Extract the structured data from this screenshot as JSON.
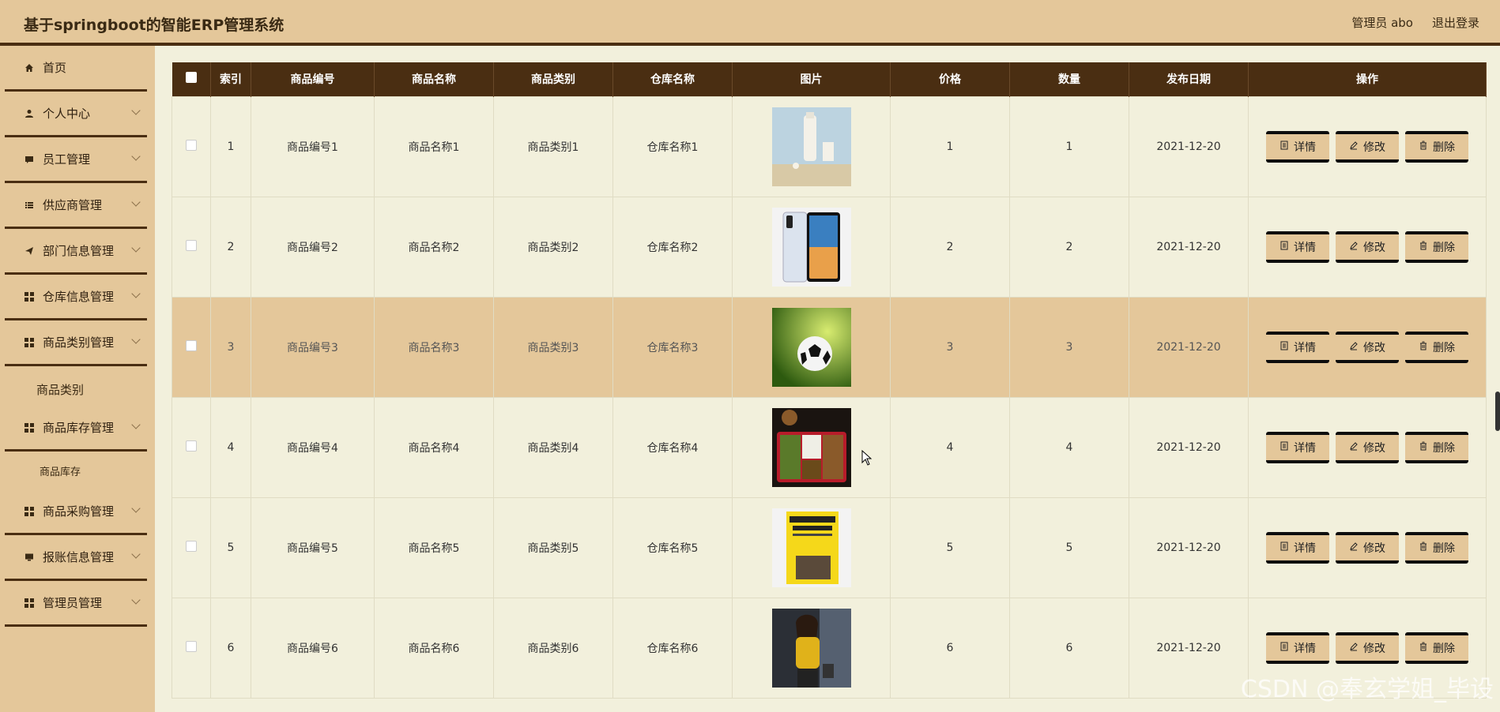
{
  "header": {
    "title": "基于springboot的智能ERP管理系统",
    "user": "管理员 abo",
    "logout": "退出登录"
  },
  "sidebar": {
    "items": [
      {
        "label": "首页"
      },
      {
        "label": "个人中心"
      },
      {
        "label": "员工管理"
      },
      {
        "label": "供应商管理"
      },
      {
        "label": "部门信息管理"
      },
      {
        "label": "仓库信息管理"
      },
      {
        "label": "商品类别管理"
      },
      {
        "label": "商品库存管理"
      },
      {
        "label": "商品采购管理"
      },
      {
        "label": "报账信息管理"
      },
      {
        "label": "管理员管理"
      }
    ],
    "sub_category": "商品类别",
    "sub_stock": "商品库存"
  },
  "table": {
    "headers": [
      "索引",
      "商品编号",
      "商品名称",
      "商品类别",
      "仓库名称",
      "图片",
      "价格",
      "数量",
      "发布日期",
      "操作"
    ],
    "rows": [
      {
        "index": "1",
        "code": "商品编号1",
        "name": "商品名称1",
        "category": "商品类别1",
        "warehouse": "仓库名称1",
        "image": "milk-bottle",
        "price": "1",
        "qty": "1",
        "date": "2021-12-20"
      },
      {
        "index": "2",
        "code": "商品编号2",
        "name": "商品名称2",
        "category": "商品类别2",
        "warehouse": "仓库名称2",
        "image": "smartphone",
        "price": "2",
        "qty": "2",
        "date": "2021-12-20"
      },
      {
        "index": "3",
        "code": "商品编号3",
        "name": "商品名称3",
        "category": "商品类别3",
        "warehouse": "仓库名称3",
        "image": "soccer-ball",
        "price": "3",
        "qty": "3",
        "date": "2021-12-20"
      },
      {
        "index": "4",
        "code": "商品编号4",
        "name": "商品名称4",
        "category": "商品类别4",
        "warehouse": "仓库名称4",
        "image": "food-box",
        "price": "4",
        "qty": "4",
        "date": "2021-12-20"
      },
      {
        "index": "5",
        "code": "商品编号5",
        "name": "商品名称5",
        "category": "商品类别5",
        "warehouse": "仓库名称5",
        "image": "yellow-book",
        "price": "5",
        "qty": "5",
        "date": "2021-12-20"
      },
      {
        "index": "6",
        "code": "商品编号6",
        "name": "商品名称6",
        "category": "商品类别6",
        "warehouse": "仓库名称6",
        "image": "woman-photo",
        "price": "6",
        "qty": "6",
        "date": "2021-12-20"
      }
    ],
    "highlight_row": 3,
    "actions": {
      "detail": "详情",
      "edit": "修改",
      "delete": "删除"
    }
  },
  "watermark": "CSDN @奉玄学姐_毕设",
  "colors": {
    "header_bg": "#e4c79a",
    "dark_brown": "#4a2e12",
    "content_bg": "#f2f0dc"
  }
}
